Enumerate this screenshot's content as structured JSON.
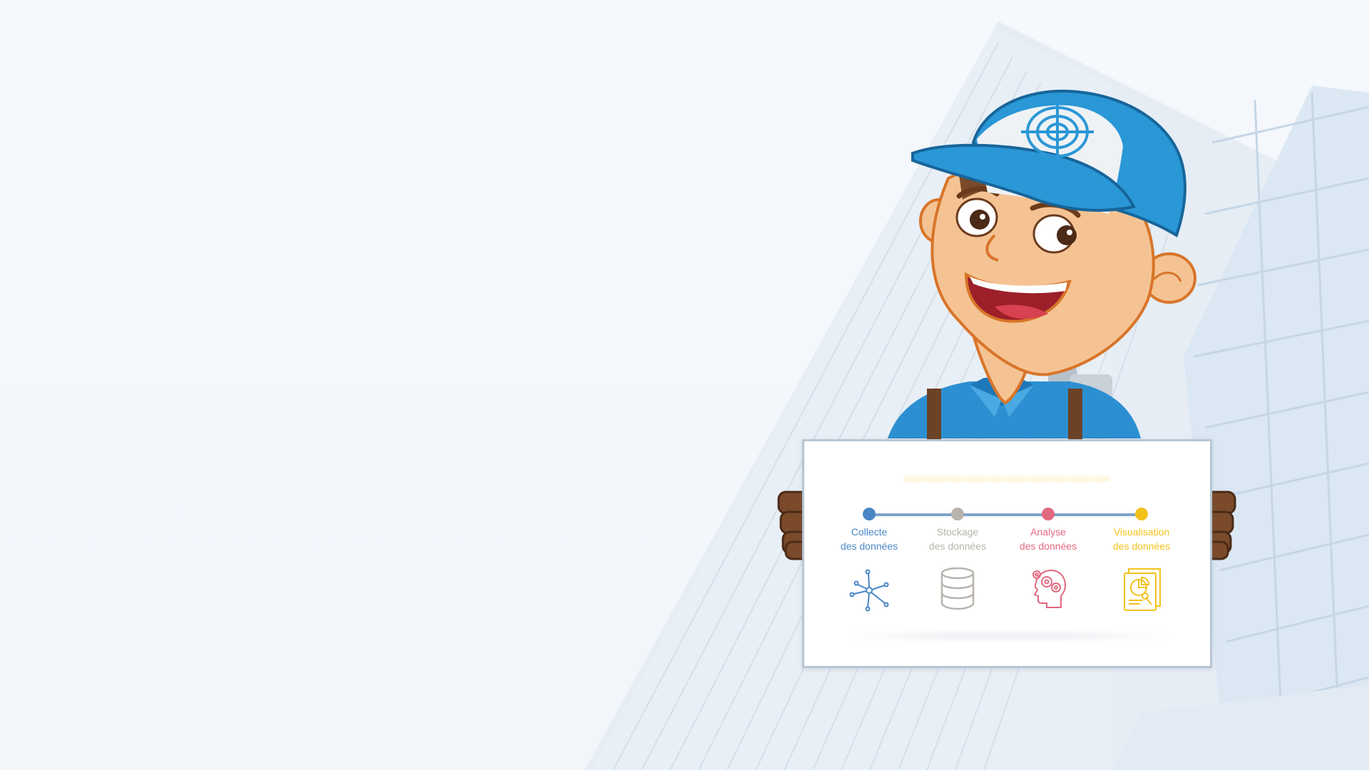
{
  "colors": {
    "background": "#f4f7fb",
    "building_tint": "#dbe6f1",
    "timeline": "#7ea3c9",
    "cap_blue": "#2a97d6",
    "shirt_blue": "#2c8fd1"
  },
  "board": {
    "steps": [
      {
        "line1": "Collecte",
        "line2": "des données",
        "color": "#4a86c5",
        "icon": "network-nodes-icon"
      },
      {
        "line1": "Stockage",
        "line2": "des données",
        "color": "#b8b3ad",
        "icon": "database-icon"
      },
      {
        "line1": "Analyse",
        "line2": "des données",
        "color": "#e0697f",
        "icon": "brain-gears-icon"
      },
      {
        "line1": "Visualisation",
        "line2": "des données",
        "color": "#f2c21b",
        "icon": "report-chart-icon"
      }
    ]
  },
  "cap_logo": "target-crosshair-icon"
}
